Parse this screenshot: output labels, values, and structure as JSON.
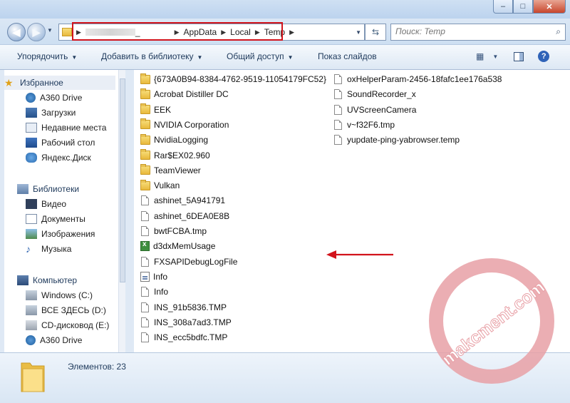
{
  "window": {
    "caption_buttons": {
      "minimize": "–",
      "maximize": "□",
      "close": "✕"
    }
  },
  "navigation": {
    "back_icon": "back-arrow-icon",
    "forward_icon": "forward-arrow-icon",
    "address": {
      "hidden_segment": "_",
      "segments": [
        "AppData",
        "Local",
        "Temp"
      ]
    },
    "search_placeholder": "Поиск: Temp"
  },
  "toolbar": {
    "organize": "Упорядочить",
    "add_to_library": "Добавить в библиотеку",
    "share": "Общий доступ",
    "slideshow": "Показ слайдов"
  },
  "nav_pane": {
    "favorites": {
      "label": "Избранное",
      "items": [
        "A360 Drive",
        "Загрузки",
        "Недавние места",
        "Рабочий стол",
        "Яндекс.Диск"
      ]
    },
    "libraries": {
      "label": "Библиотеки",
      "items": [
        "Видео",
        "Документы",
        "Изображения",
        "Музыка"
      ]
    },
    "computer": {
      "label": "Компьютер",
      "items": [
        "Windows (C:)",
        "ВСЕ ЗДЕСЬ (D:)",
        "CD-дисковод (E:)",
        "A360 Drive"
      ]
    }
  },
  "files_col1": [
    {
      "name": "{673A0B94-8384-4762-9519-11054179FC52}",
      "type": "folder"
    },
    {
      "name": "Acrobat Distiller DC",
      "type": "folder"
    },
    {
      "name": "EEK",
      "type": "folder"
    },
    {
      "name": "NVIDIA Corporation",
      "type": "folder"
    },
    {
      "name": "NvidiaLogging",
      "type": "folder"
    },
    {
      "name": "Rar$EX02.960",
      "type": "folder"
    },
    {
      "name": "TeamViewer",
      "type": "folder"
    },
    {
      "name": "Vulkan",
      "type": "folder"
    },
    {
      "name": "ashinet_5A941791",
      "type": "file"
    },
    {
      "name": "ashinet_6DEA0E8B",
      "type": "file"
    },
    {
      "name": "bwtFCBA.tmp",
      "type": "file"
    },
    {
      "name": "d3dxMemUsage",
      "type": "excel"
    },
    {
      "name": "FXSAPIDebugLogFile",
      "type": "file"
    },
    {
      "name": "Info",
      "type": "config"
    },
    {
      "name": "Info",
      "type": "file"
    },
    {
      "name": "INS_91b5836.TMP",
      "type": "file"
    },
    {
      "name": "INS_308a7ad3.TMP",
      "type": "file"
    },
    {
      "name": "INS_ecc5bdfc.TMP",
      "type": "file"
    }
  ],
  "files_col2": [
    {
      "name": "oxHelperParam-2456-18fafc1ee176a538",
      "type": "file"
    },
    {
      "name": "SoundRecorder_x",
      "type": "file"
    },
    {
      "name": "UVScreenCamera",
      "type": "file"
    },
    {
      "name": "v~f32F6.tmp",
      "type": "file"
    },
    {
      "name": "yupdate-ping-yabrowser.temp",
      "type": "file"
    }
  ],
  "status": {
    "count_text": "Элементов: 23"
  },
  "watermark": {
    "text": "makcment.com"
  },
  "colors": {
    "annotation_red": "#d2131b",
    "watermark_pink": "#e8a0a6"
  }
}
